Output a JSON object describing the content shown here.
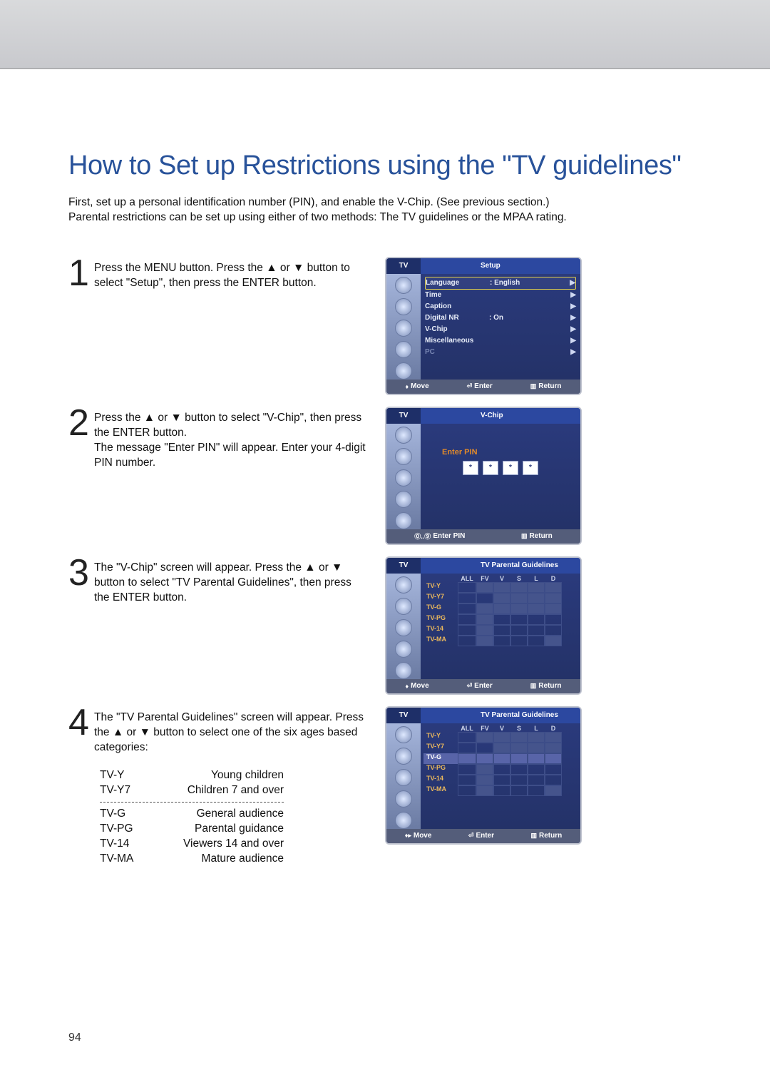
{
  "title": "How to Set up Restrictions using the \"TV guidelines\"",
  "intro": "First, set up a personal identification number (PIN), and enable the V-Chip. (See previous section.)\nParental restrictions can be set up using either of two methods: The TV guidelines or the MPAA rating.",
  "steps": {
    "s1": {
      "num": "1",
      "text": "Press the MENU button. Press the ▲ or ▼ button to select \"Setup\", then press the ENTER button."
    },
    "s2": {
      "num": "2",
      "text": "Press the ▲ or ▼ button to select \"V-Chip\", then press the ENTER button.\nThe message \"Enter PIN\" will appear. Enter your 4-digit PIN number."
    },
    "s3": {
      "num": "3",
      "text": "The \"V-Chip\" screen will appear. Press the ▲ or ▼ button to select \"TV Parental Guidelines\", then press the ENTER button."
    },
    "s4": {
      "num": "4",
      "text": "The \"TV Parental Guidelines\" screen will appear. Press the ▲ or ▼ button to select one of the six ages based categories:"
    }
  },
  "ratings": [
    {
      "code": "TV-Y",
      "desc": "Young children"
    },
    {
      "code": "TV-Y7",
      "desc": "Children 7 and over"
    },
    {
      "code": "TV-G",
      "desc": "General audience"
    },
    {
      "code": "TV-PG",
      "desc": "Parental guidance"
    },
    {
      "code": "TV-14",
      "desc": "Viewers 14 and over"
    },
    {
      "code": "TV-MA",
      "desc": "Mature audience"
    }
  ],
  "osd": {
    "tv": "TV",
    "setup": {
      "title": "Setup",
      "items": [
        {
          "label": "Language",
          "value": ":  English"
        },
        {
          "label": "Time",
          "value": ""
        },
        {
          "label": "Caption",
          "value": ""
        },
        {
          "label": "Digital NR",
          "value": ":  On"
        },
        {
          "label": "V-Chip",
          "value": ""
        },
        {
          "label": "Miscellaneous",
          "value": ""
        },
        {
          "label": "PC",
          "value": ""
        }
      ]
    },
    "pin": {
      "title": "V-Chip",
      "prompt": "Enter PIN",
      "star": "*"
    },
    "guide": {
      "title": "TV Parental Guidelines",
      "cols": [
        "ALL",
        "FV",
        "V",
        "S",
        "L",
        "D"
      ],
      "rows": [
        "TV-Y",
        "TV-Y7",
        "TV-G",
        "TV-PG",
        "TV-14",
        "TV-MA"
      ]
    },
    "foot": {
      "move": "Move",
      "enter": "Enter",
      "ret": "Return",
      "enterpin": "Enter PIN",
      "num": "0..9"
    }
  },
  "pnum": "94"
}
